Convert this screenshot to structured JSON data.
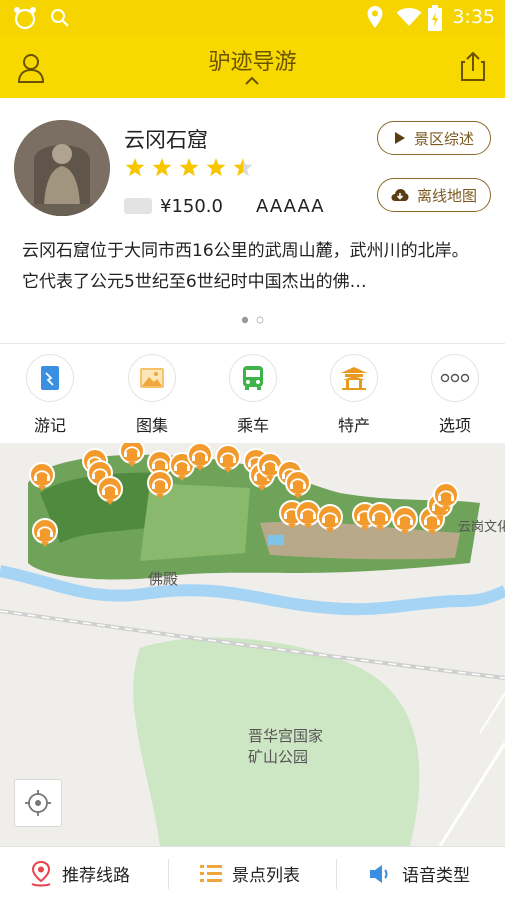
{
  "status": {
    "time": "3:35"
  },
  "app": {
    "title": "驴迹导游"
  },
  "attraction": {
    "name": "云冈石窟",
    "rating": 4.5,
    "price": "¥150.0",
    "grade": "AAAAA",
    "overview_button": "景区综述",
    "offline_map_button": "离线地图",
    "description": "云冈石窟位于大同市西16公里的武周山麓，武州川的北岸。它代表了公元5世纪至6世纪时中国杰出的佛…",
    "page_indicator": {
      "count": 2,
      "active": 0
    }
  },
  "quick_actions": [
    {
      "label": "游记",
      "icon": "book-icon",
      "color": "#3a8fe0"
    },
    {
      "label": "图集",
      "icon": "picture-icon",
      "color": "#f0a63a"
    },
    {
      "label": "乘车",
      "icon": "bus-icon",
      "color": "#3fb24a"
    },
    {
      "label": "特产",
      "icon": "pavilion-icon",
      "color": "#e89a1e"
    },
    {
      "label": "选项",
      "icon": "more-icon",
      "color": "#555555"
    }
  ],
  "map": {
    "labels": {
      "buddha_hall": "佛殿",
      "culture": "云岗文化",
      "park_line1": "晋华宫国家",
      "park_line2": "矿山公园"
    }
  },
  "bottom_bar": [
    {
      "label": "推荐线路",
      "icon": "route-pin-icon"
    },
    {
      "label": "景点列表",
      "icon": "list-icon"
    },
    {
      "label": "语音类型",
      "icon": "speaker-icon"
    }
  ],
  "colors": {
    "header": "#f7d900",
    "accent": "#f0a63a",
    "pill_border": "#8a6a2c"
  }
}
